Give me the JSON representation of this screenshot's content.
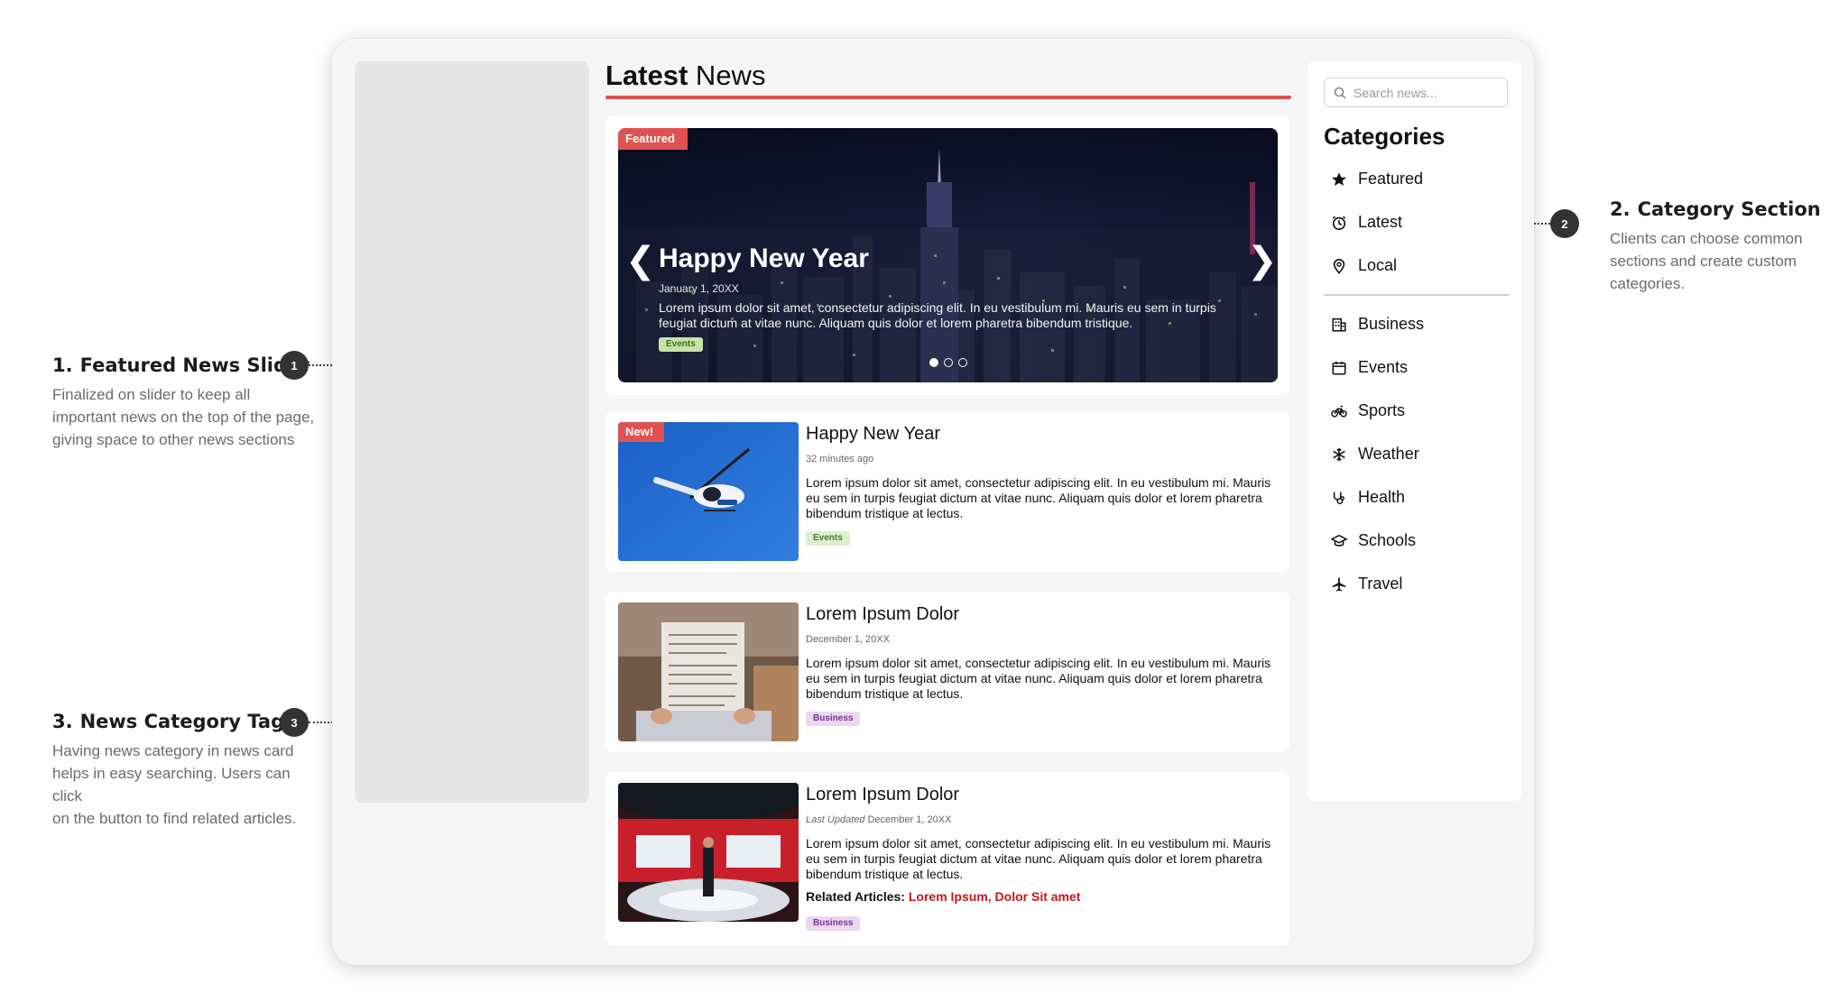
{
  "annotations": [
    {
      "num": "1.",
      "title": "Featured News Slider",
      "marker": "1",
      "desc": [
        "Finalized on slider to keep all",
        "important news on the top of the page,",
        "giving space to other news sections"
      ]
    },
    {
      "num": "2.",
      "title": "Category Section",
      "marker": "2",
      "desc": [
        "Clients can choose common",
        "sections and create custom",
        "categories."
      ]
    },
    {
      "num": "3.",
      "title": "News Category Tags",
      "marker": "3",
      "desc": [
        "Having news category in news card",
        "helps in easy searching. Users can click",
        "on the button to find related articles."
      ]
    }
  ],
  "header": {
    "title_bold": "Latest",
    "title_rest": " News"
  },
  "featured": {
    "ribbon": "Featured",
    "title": "Happy New Year",
    "date": "January 1, 20XX",
    "body": "Lorem ipsum dolor sit amet, consectetur adipiscing elit. In eu vestibulum mi. Mauris eu sem in turpis feugiat dictum at vitae nunc. Aliquam quis dolor et lorem pharetra bibendum tristique.",
    "tag": "Events",
    "prev_glyph": "❮",
    "next_glyph": "❯",
    "slide_count": 3,
    "active_slide": 1
  },
  "news": [
    {
      "badge": "New!",
      "title": "Happy New Year",
      "meta_prefix": "",
      "meta": "32 minutes ago",
      "body": "Lorem ipsum dolor sit amet, consectetur adipiscing elit. In eu vestibulum mi. Mauris eu sem in turpis feugiat dictum at vitae nunc. Aliquam quis dolor et lorem pharetra bibendum tristique at lectus.",
      "tag": "Events"
    },
    {
      "badge": "",
      "title": "Lorem Ipsum Dolor",
      "meta_prefix": "",
      "meta": "December 1, 20XX",
      "body": "Lorem ipsum dolor sit amet, consectetur adipiscing elit. In eu vestibulum mi. Mauris eu sem in turpis feugiat dictum at vitae nunc. Aliquam quis dolor et lorem pharetra bibendum tristique at lectus.",
      "tag": "Business"
    },
    {
      "badge": "",
      "title": "Lorem Ipsum Dolor",
      "meta_prefix": "Last Updated",
      "meta": " December 1, 20XX",
      "body": "Lorem ipsum dolor sit amet, consectetur adipiscing elit. In eu vestibulum mi. Mauris eu sem in turpis feugiat dictum at vitae nunc. Aliquam quis dolor et lorem pharetra bibendum tristique at lectus.",
      "related_label": "Related Articles: ",
      "related_links": [
        "Lorem Ipsum",
        "Dolor Sit amet"
      ],
      "related_sep": ", ",
      "tag": "Business"
    }
  ],
  "sidebar": {
    "search_placeholder": "Search news...",
    "heading": "Categories",
    "primary": [
      {
        "label": "Featured",
        "icon": "star-icon"
      },
      {
        "label": "Latest",
        "icon": "alarm-clock-icon"
      },
      {
        "label": "Local",
        "icon": "map-pin-icon"
      }
    ],
    "secondary": [
      {
        "label": "Business",
        "icon": "building-icon"
      },
      {
        "label": "Events",
        "icon": "calendar-icon"
      },
      {
        "label": "Sports",
        "icon": "bicycle-icon"
      },
      {
        "label": "Weather",
        "icon": "snowflake-icon"
      },
      {
        "label": "Health",
        "icon": "stethoscope-icon"
      },
      {
        "label": "Schools",
        "icon": "graduation-cap-icon"
      },
      {
        "label": "Travel",
        "icon": "airplane-icon"
      }
    ]
  },
  "colors": {
    "accent": "#d9534f",
    "badge": "#e05251",
    "link": "#c4161c",
    "events_tag": "#dcefcf",
    "business_tag": "#ead8f0"
  }
}
